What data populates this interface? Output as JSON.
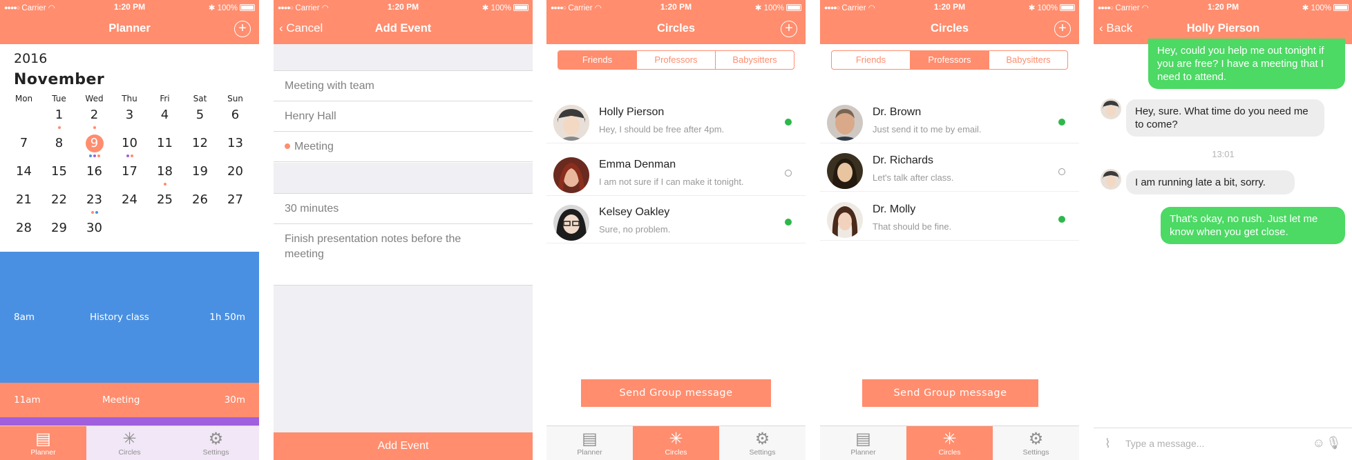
{
  "status": {
    "carrier": "Carrier",
    "time": "1:20 PM",
    "battery": "100%"
  },
  "planner": {
    "title": "Planner",
    "year": "2016",
    "month": "November",
    "weekdays": [
      "Mon",
      "Tue",
      "Wed",
      "Thu",
      "Fri",
      "Sat",
      "Sun"
    ],
    "weeks": [
      [
        "",
        "1",
        "2",
        "3",
        "4",
        "5",
        "6"
      ],
      [
        "7",
        "8",
        "9",
        "10",
        "11",
        "12",
        "13"
      ],
      [
        "14",
        "15",
        "16",
        "17",
        "18",
        "19",
        "20"
      ],
      [
        "21",
        "22",
        "23",
        "24",
        "25",
        "26",
        "27"
      ],
      [
        "28",
        "29",
        "30",
        "",
        "",
        "",
        ""
      ]
    ],
    "today": "9",
    "events": [
      {
        "time": "8am",
        "title": "History class",
        "duration": "1h 50m",
        "color": "#4a90e2"
      },
      {
        "time": "11am",
        "title": "Meeting",
        "duration": "30m",
        "color": "#ff8d6e"
      }
    ],
    "extra_event_color": "#a05fdd"
  },
  "tabs": {
    "planner": "Planner",
    "circles": "Circles",
    "settings": "Settings"
  },
  "add_event": {
    "cancel": "Cancel",
    "title": "Add Event",
    "name": "Meeting with team",
    "location": "Henry Hall",
    "category": "Meeting",
    "reminder": "30 minutes",
    "notes": "Finish presentation notes before the meeting",
    "submit": "Add Event"
  },
  "circles": {
    "title": "Circles",
    "segments": [
      "Friends",
      "Professors",
      "Babysitters"
    ],
    "friends": [
      {
        "name": "Holly Pierson",
        "message": "Hey, I should be free after 4pm.",
        "online": true
      },
      {
        "name": "Emma Denman",
        "message": "I am not sure if I can make it tonight.",
        "online": false
      },
      {
        "name": "Kelsey Oakley",
        "message": "Sure, no problem.",
        "online": true
      }
    ],
    "professors": [
      {
        "name": "Dr. Brown",
        "message": "Just send it to me by email.",
        "online": true
      },
      {
        "name": "Dr. Richards",
        "message": "Let's talk after class.",
        "online": false
      },
      {
        "name": "Dr. Molly",
        "message": "That should be fine.",
        "online": true
      }
    ],
    "group_button": "Send Group message"
  },
  "chat": {
    "back": "Back",
    "title": "Holly Pierson",
    "messages": [
      {
        "from": "me",
        "text": "Hey, could you help me out tonight if you are free? I have a meeting that I need to attend."
      },
      {
        "from": "them",
        "text": "Hey, sure. What time do you need me to come?"
      },
      {
        "from": "them",
        "text": "I am running late a bit, sorry."
      },
      {
        "from": "me",
        "text": "That's okay, no rush. Just let me know when you get close."
      }
    ],
    "timestamp": "13:01",
    "placeholder": "Type a message..."
  },
  "colors": {
    "accent": "#ff8d6e",
    "online": "#2db84a",
    "sent_bubble": "#4cd964"
  }
}
